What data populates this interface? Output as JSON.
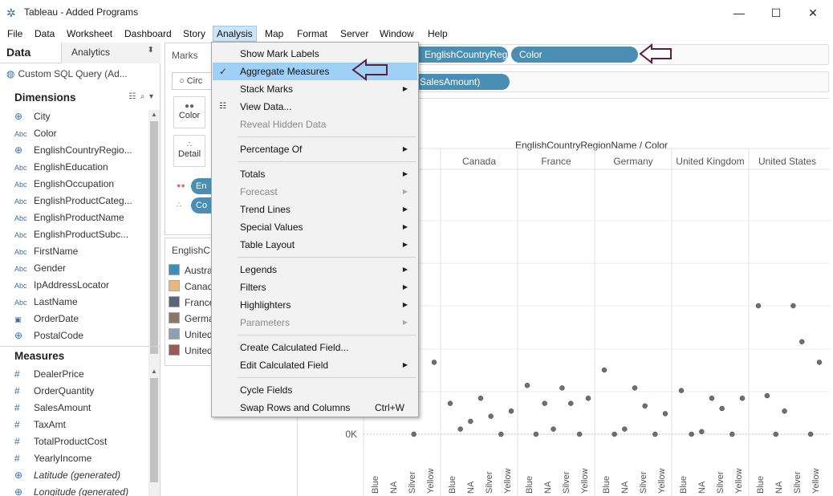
{
  "window": {
    "title": "Tableau - Added Programs",
    "minimize": "—",
    "maximize": "☐",
    "close": "✕"
  },
  "menubar": [
    "File",
    "Data",
    "Worksheet",
    "Dashboard",
    "Story",
    "Analysis",
    "Map",
    "Format",
    "Server",
    "Window",
    "Help"
  ],
  "left": {
    "tab_data": "Data",
    "tab_analytics": "Analytics",
    "datasource": "Custom SQL Query (Ad...",
    "dimensions_header": "Dimensions",
    "dimensions": [
      {
        "icon": "globe",
        "name": "City"
      },
      {
        "icon": "Abc",
        "name": "Color"
      },
      {
        "icon": "globe",
        "name": "EnglishCountryRegio..."
      },
      {
        "icon": "Abc",
        "name": "EnglishEducation"
      },
      {
        "icon": "Abc",
        "name": "EnglishOccupation"
      },
      {
        "icon": "Abc",
        "name": "EnglishProductCateg..."
      },
      {
        "icon": "Abc",
        "name": "EnglishProductName"
      },
      {
        "icon": "Abc",
        "name": "EnglishProductSubc..."
      },
      {
        "icon": "Abc",
        "name": "FirstName"
      },
      {
        "icon": "Abc",
        "name": "Gender"
      },
      {
        "icon": "Abc",
        "name": "IpAddressLocator"
      },
      {
        "icon": "Abc",
        "name": "LastName"
      },
      {
        "icon": "calendar",
        "name": "OrderDate"
      },
      {
        "icon": "globe",
        "name": "PostalCode"
      }
    ],
    "measures_header": "Measures",
    "measures": [
      {
        "icon": "#",
        "name": "DealerPrice",
        "italic": false
      },
      {
        "icon": "#",
        "name": "OrderQuantity",
        "italic": false
      },
      {
        "icon": "#",
        "name": "SalesAmount",
        "italic": false
      },
      {
        "icon": "#",
        "name": "TaxAmt",
        "italic": false
      },
      {
        "icon": "#",
        "name": "TotalProductCost",
        "italic": false
      },
      {
        "icon": "#",
        "name": "YearlyIncome",
        "italic": false
      },
      {
        "icon": "globe",
        "name": "Latitude (generated)",
        "italic": true
      },
      {
        "icon": "globe",
        "name": "Longitude (generated)",
        "italic": true
      }
    ]
  },
  "marks": {
    "title": "Marks",
    "marktype": "Circ",
    "color_label": "Color",
    "detail_label": "Detail",
    "pill1": "En",
    "pill2": "Co"
  },
  "legend": {
    "title": "EnglishC",
    "items": [
      {
        "label": "Austra",
        "color": "#3f8fb5"
      },
      {
        "label": "Canad",
        "color": "#e8b77c"
      },
      {
        "label": "France",
        "color": "#5b6478"
      },
      {
        "label": "Germa",
        "color": "#8a7569"
      },
      {
        "label": "United",
        "color": "#8fa0b2"
      },
      {
        "label": "United",
        "color": "#9a5a59"
      }
    ]
  },
  "shelves": {
    "columns_pill1": "EnglishCountryRegion..",
    "columns_pill2": "Color",
    "rows_pill": "SalesAmount)"
  },
  "chart_data": {
    "type": "scatter",
    "title": "EnglishCountryRegionName / Color",
    "panes": [
      "Australia",
      "Canada",
      "France",
      "Germany",
      "United Kingdom",
      "United States"
    ],
    "pane_labels_visible": [
      "Canada",
      "France",
      "Germany",
      "United Kingdom",
      "United States"
    ],
    "categories": [
      "Blue",
      "NA",
      "Silver",
      "Yellow"
    ],
    "y_tick_labels": [
      "0K"
    ],
    "series": [
      {
        "name": "Australia",
        "values": [
          null,
          0.12,
          0.0,
          0.28
        ]
      },
      {
        "name": "Canada",
        "values": [
          0.12,
          0.02,
          0.05,
          0.14,
          0.07,
          0.0,
          0.09
        ]
      },
      {
        "name": "France",
        "values": [
          0.19,
          0.0,
          0.12,
          0.02,
          0.18,
          0.12,
          0.0,
          0.14
        ]
      },
      {
        "name": "Germany",
        "values": [
          0.25,
          0.0,
          0.02,
          0.18,
          0.11,
          0.0,
          0.08
        ]
      },
      {
        "name": "United Kingdom",
        "values": [
          0.17,
          0.0,
          0.01,
          0.14,
          0.1,
          0.0,
          0.14
        ]
      },
      {
        "name": "United States",
        "values": [
          0.5,
          0.15,
          0.0,
          0.09,
          0.5,
          0.36,
          0.0,
          0.28
        ]
      }
    ]
  },
  "dropdown": {
    "items": [
      {
        "label": "Show Mark Labels",
        "sub": false,
        "disabled": false
      },
      {
        "label": "Aggregate Measures",
        "sub": false,
        "disabled": false,
        "checked": true,
        "highlight": true
      },
      {
        "label": "Stack Marks",
        "sub": true,
        "disabled": false
      },
      {
        "label": "View Data...",
        "sub": false,
        "disabled": false,
        "lead_icon": true
      },
      {
        "label": "Reveal Hidden Data",
        "sub": false,
        "disabled": true
      },
      {
        "label": "Percentage Of",
        "sub": true,
        "disabled": false
      },
      {
        "label": "Totals",
        "sub": true,
        "disabled": false
      },
      {
        "label": "Forecast",
        "sub": true,
        "disabled": true
      },
      {
        "label": "Trend Lines",
        "sub": true,
        "disabled": false
      },
      {
        "label": "Special Values",
        "sub": true,
        "disabled": false
      },
      {
        "label": "Table Layout",
        "sub": true,
        "disabled": false
      },
      {
        "label": "Legends",
        "sub": true,
        "disabled": false
      },
      {
        "label": "Filters",
        "sub": true,
        "disabled": false
      },
      {
        "label": "Highlighters",
        "sub": true,
        "disabled": false
      },
      {
        "label": "Parameters",
        "sub": true,
        "disabled": true
      },
      {
        "label": "Create Calculated Field...",
        "sub": false,
        "disabled": false
      },
      {
        "label": "Edit Calculated Field",
        "sub": true,
        "disabled": false
      },
      {
        "label": "Cycle Fields",
        "sub": false,
        "disabled": false
      },
      {
        "label": "Swap Rows and Columns",
        "sub": false,
        "disabled": false,
        "shortcut": "Ctrl+W"
      }
    ],
    "check_glyph": "✓"
  },
  "colors": {
    "pill": "#4a8fb3",
    "menu_highlight": "#9fd1f7",
    "arrow": "#5a1f3a"
  }
}
